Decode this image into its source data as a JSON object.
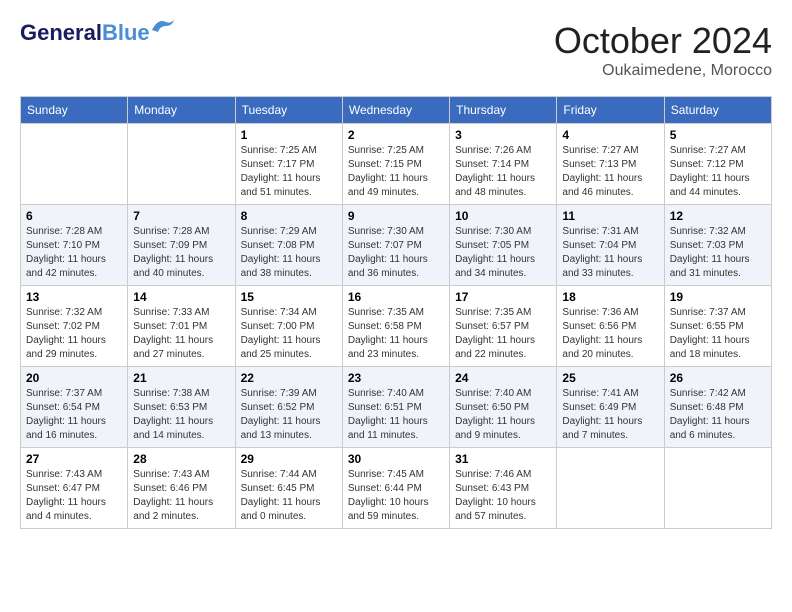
{
  "header": {
    "logo_general": "General",
    "logo_blue": "Blue",
    "month": "October 2024",
    "location": "Oukaimedene, Morocco"
  },
  "calendar": {
    "days_of_week": [
      "Sunday",
      "Monday",
      "Tuesday",
      "Wednesday",
      "Thursday",
      "Friday",
      "Saturday"
    ],
    "weeks": [
      [
        {
          "day": "",
          "info": ""
        },
        {
          "day": "",
          "info": ""
        },
        {
          "day": "1",
          "info": "Sunrise: 7:25 AM\nSunset: 7:17 PM\nDaylight: 11 hours and 51 minutes."
        },
        {
          "day": "2",
          "info": "Sunrise: 7:25 AM\nSunset: 7:15 PM\nDaylight: 11 hours and 49 minutes."
        },
        {
          "day": "3",
          "info": "Sunrise: 7:26 AM\nSunset: 7:14 PM\nDaylight: 11 hours and 48 minutes."
        },
        {
          "day": "4",
          "info": "Sunrise: 7:27 AM\nSunset: 7:13 PM\nDaylight: 11 hours and 46 minutes."
        },
        {
          "day": "5",
          "info": "Sunrise: 7:27 AM\nSunset: 7:12 PM\nDaylight: 11 hours and 44 minutes."
        }
      ],
      [
        {
          "day": "6",
          "info": "Sunrise: 7:28 AM\nSunset: 7:10 PM\nDaylight: 11 hours and 42 minutes."
        },
        {
          "day": "7",
          "info": "Sunrise: 7:28 AM\nSunset: 7:09 PM\nDaylight: 11 hours and 40 minutes."
        },
        {
          "day": "8",
          "info": "Sunrise: 7:29 AM\nSunset: 7:08 PM\nDaylight: 11 hours and 38 minutes."
        },
        {
          "day": "9",
          "info": "Sunrise: 7:30 AM\nSunset: 7:07 PM\nDaylight: 11 hours and 36 minutes."
        },
        {
          "day": "10",
          "info": "Sunrise: 7:30 AM\nSunset: 7:05 PM\nDaylight: 11 hours and 34 minutes."
        },
        {
          "day": "11",
          "info": "Sunrise: 7:31 AM\nSunset: 7:04 PM\nDaylight: 11 hours and 33 minutes."
        },
        {
          "day": "12",
          "info": "Sunrise: 7:32 AM\nSunset: 7:03 PM\nDaylight: 11 hours and 31 minutes."
        }
      ],
      [
        {
          "day": "13",
          "info": "Sunrise: 7:32 AM\nSunset: 7:02 PM\nDaylight: 11 hours and 29 minutes."
        },
        {
          "day": "14",
          "info": "Sunrise: 7:33 AM\nSunset: 7:01 PM\nDaylight: 11 hours and 27 minutes."
        },
        {
          "day": "15",
          "info": "Sunrise: 7:34 AM\nSunset: 7:00 PM\nDaylight: 11 hours and 25 minutes."
        },
        {
          "day": "16",
          "info": "Sunrise: 7:35 AM\nSunset: 6:58 PM\nDaylight: 11 hours and 23 minutes."
        },
        {
          "day": "17",
          "info": "Sunrise: 7:35 AM\nSunset: 6:57 PM\nDaylight: 11 hours and 22 minutes."
        },
        {
          "day": "18",
          "info": "Sunrise: 7:36 AM\nSunset: 6:56 PM\nDaylight: 11 hours and 20 minutes."
        },
        {
          "day": "19",
          "info": "Sunrise: 7:37 AM\nSunset: 6:55 PM\nDaylight: 11 hours and 18 minutes."
        }
      ],
      [
        {
          "day": "20",
          "info": "Sunrise: 7:37 AM\nSunset: 6:54 PM\nDaylight: 11 hours and 16 minutes."
        },
        {
          "day": "21",
          "info": "Sunrise: 7:38 AM\nSunset: 6:53 PM\nDaylight: 11 hours and 14 minutes."
        },
        {
          "day": "22",
          "info": "Sunrise: 7:39 AM\nSunset: 6:52 PM\nDaylight: 11 hours and 13 minutes."
        },
        {
          "day": "23",
          "info": "Sunrise: 7:40 AM\nSunset: 6:51 PM\nDaylight: 11 hours and 11 minutes."
        },
        {
          "day": "24",
          "info": "Sunrise: 7:40 AM\nSunset: 6:50 PM\nDaylight: 11 hours and 9 minutes."
        },
        {
          "day": "25",
          "info": "Sunrise: 7:41 AM\nSunset: 6:49 PM\nDaylight: 11 hours and 7 minutes."
        },
        {
          "day": "26",
          "info": "Sunrise: 7:42 AM\nSunset: 6:48 PM\nDaylight: 11 hours and 6 minutes."
        }
      ],
      [
        {
          "day": "27",
          "info": "Sunrise: 7:43 AM\nSunset: 6:47 PM\nDaylight: 11 hours and 4 minutes."
        },
        {
          "day": "28",
          "info": "Sunrise: 7:43 AM\nSunset: 6:46 PM\nDaylight: 11 hours and 2 minutes."
        },
        {
          "day": "29",
          "info": "Sunrise: 7:44 AM\nSunset: 6:45 PM\nDaylight: 11 hours and 0 minutes."
        },
        {
          "day": "30",
          "info": "Sunrise: 7:45 AM\nSunset: 6:44 PM\nDaylight: 10 hours and 59 minutes."
        },
        {
          "day": "31",
          "info": "Sunrise: 7:46 AM\nSunset: 6:43 PM\nDaylight: 10 hours and 57 minutes."
        },
        {
          "day": "",
          "info": ""
        },
        {
          "day": "",
          "info": ""
        }
      ]
    ]
  }
}
